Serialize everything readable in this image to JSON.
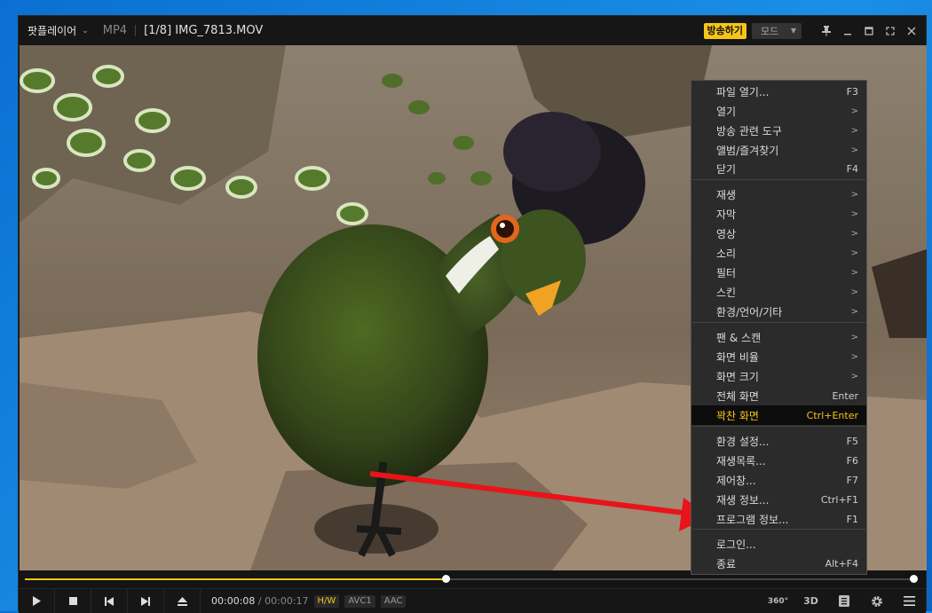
{
  "titlebar": {
    "app_name": "팟플레이어",
    "format": "MP4",
    "file_info": "[1/8] IMG_7813.MOV",
    "broadcast_label": "방송하기",
    "mode_label": "모드"
  },
  "controls": {
    "current_time": "00:00:08",
    "separator": "/",
    "duration": "00:00:17",
    "badges": [
      "H/W",
      "AVC1",
      "AAC"
    ],
    "label_360": "360°",
    "label_3d": "3D"
  },
  "seek": {
    "progress": 0.4719
  },
  "context_menu": {
    "items": [
      {
        "label": "파일 열기...",
        "shortcut": "F3"
      },
      {
        "label": "열기",
        "shortcut": ">"
      },
      {
        "label": "방송 관련 도구",
        "shortcut": ">"
      },
      {
        "label": "앨범/즐겨찾기",
        "shortcut": ">"
      },
      {
        "label": "닫기",
        "shortcut": "F4"
      },
      {
        "label": "재생",
        "shortcut": ">"
      },
      {
        "label": "자막",
        "shortcut": ">"
      },
      {
        "label": "영상",
        "shortcut": ">"
      },
      {
        "label": "소리",
        "shortcut": ">"
      },
      {
        "label": "필터",
        "shortcut": ">"
      },
      {
        "label": "스킨",
        "shortcut": ">"
      },
      {
        "label": "환경/언어/기타",
        "shortcut": ">"
      },
      {
        "label": "팬 & 스캔",
        "shortcut": ">"
      },
      {
        "label": "화면 비율",
        "shortcut": ">"
      },
      {
        "label": "화면 크기",
        "shortcut": ">"
      },
      {
        "label": "전체 화면",
        "shortcut": "Enter"
      },
      {
        "label": "꽉찬 화면",
        "shortcut": "Ctrl+Enter"
      },
      {
        "label": "환경 설정...",
        "shortcut": "F5"
      },
      {
        "label": "재생목록...",
        "shortcut": "F6"
      },
      {
        "label": "제어창...",
        "shortcut": "F7"
      },
      {
        "label": "재생 정보...",
        "shortcut": "Ctrl+F1"
      },
      {
        "label": "프로그램 정보...",
        "shortcut": "F1"
      },
      {
        "label": "로그인...",
        "shortcut": ""
      },
      {
        "label": "종료",
        "shortcut": "Alt+F4"
      }
    ],
    "highlighted_index": 16
  },
  "colors": {
    "accent": "#f5c518",
    "annotation_arrow": "#e8141a"
  }
}
